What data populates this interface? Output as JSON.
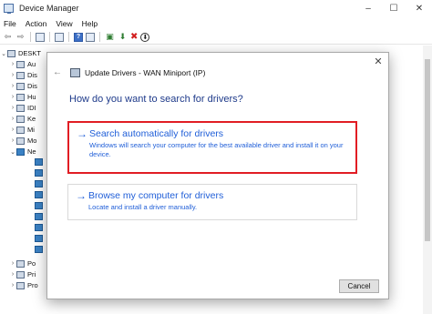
{
  "window": {
    "title": "Device Manager",
    "controls": {
      "minimize": "–",
      "maximize": "☐",
      "close": "✕"
    }
  },
  "menubar": {
    "items": [
      "File",
      "Action",
      "View",
      "Help"
    ]
  },
  "toolbar": {
    "icons": [
      "back-arrow",
      "forward-arrow",
      "properties",
      "show-hide",
      "help",
      "computer",
      "update-driver",
      "uninstall",
      "disable"
    ]
  },
  "tree": {
    "root_label": "DESKT",
    "items": [
      {
        "label": "Au"
      },
      {
        "label": "Dis"
      },
      {
        "label": "Dis"
      },
      {
        "label": "Hu"
      },
      {
        "label": "IDI"
      },
      {
        "label": "Ke"
      },
      {
        "label": "Mi"
      },
      {
        "label": "Mo"
      },
      {
        "label": "Ne"
      }
    ],
    "bottom_items": [
      {
        "label": "Po"
      },
      {
        "label": "Pri"
      },
      {
        "label": "Pro"
      }
    ]
  },
  "dialog": {
    "back_symbol": "←",
    "close_symbol": "✕",
    "title": "Update Drivers - WAN Miniport (IP)",
    "question": "How do you want to search for drivers?",
    "options": [
      {
        "arrow": "→",
        "title": "Search automatically for drivers",
        "description": "Windows will search your computer for the best available driver and install it on your device."
      },
      {
        "arrow": "→",
        "title": "Browse my computer for drivers",
        "description": "Locate and install a driver manually."
      }
    ],
    "cancel_label": "Cancel"
  },
  "colors": {
    "link_blue": "#1f5ed8",
    "heading_blue": "#1e3a8a",
    "highlight_red": "#e11d24"
  }
}
